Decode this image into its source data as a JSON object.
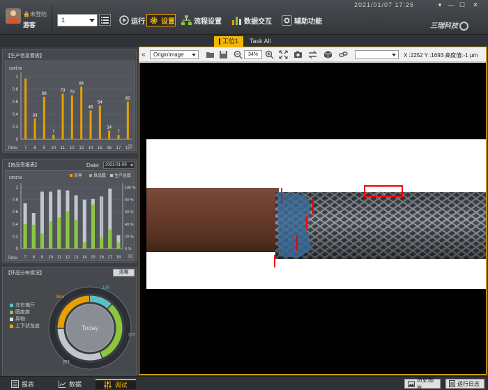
{
  "header": {
    "login_status": "未登陆",
    "user_name": "游客",
    "station_value": "1",
    "nav": {
      "run": "运行",
      "settings": "设置",
      "flow": "流程设置",
      "data": "数据交互",
      "aux": "辅助功能"
    },
    "datetime": "2021/01/07  17:26",
    "brand": "三瑞科技"
  },
  "tabs": [
    "工位1",
    "Task All"
  ],
  "production_panel": {
    "title": "【生产信息看板】",
    "unit": "unit:w",
    "time_label": "Time:",
    "chart_data": {
      "type": "bar",
      "ylabel": "unit:w",
      "ylim": [
        0,
        1
      ],
      "y_ticks": [
        "0",
        "0.2",
        "0.4",
        "0.6",
        "0.8",
        "1"
      ],
      "categories": [
        "7",
        "8",
        "9",
        "10",
        "11",
        "12",
        "13",
        "14",
        "15",
        "16",
        "17",
        "18"
      ],
      "data_labels": [
        "",
        "33",
        "68",
        "7",
        "73",
        "70",
        "84",
        "46",
        "54",
        "14",
        "7",
        "60"
      ],
      "values": [
        0.97,
        0.33,
        0.68,
        0.07,
        0.73,
        0.7,
        0.84,
        0.46,
        0.54,
        0.14,
        0.07,
        0.6
      ]
    }
  },
  "yield_panel": {
    "title": "【良品率报表】",
    "date_label": "Date:",
    "date_value": "2021-01-08",
    "unit": "unit:w",
    "time_label": "Time:",
    "legend": [
      "良率",
      "良品数",
      "生产总数"
    ],
    "chart_data": {
      "type": "bar",
      "ylim": [
        0,
        1
      ],
      "y_ticks": [
        "0",
        "0.2",
        "0.4",
        "0.6",
        "0.8",
        "1"
      ],
      "y2_ticks": [
        "0 %",
        "20 %",
        "40 %",
        "60 %",
        "80 %",
        "100 %"
      ],
      "categories": [
        "7",
        "8",
        "9",
        "10",
        "11",
        "12",
        "13",
        "14",
        "15",
        "16",
        "17",
        "18"
      ],
      "series": [
        {
          "name": "生产总数",
          "values": [
            0.74,
            0.58,
            0.93,
            0.93,
            0.96,
            0.95,
            0.87,
            0.8,
            0.81,
            0.85,
            0.98,
            0.22
          ]
        },
        {
          "name": "良品数",
          "values": [
            0.4,
            0.39,
            0.25,
            0.45,
            0.51,
            0.61,
            0.47,
            0.11,
            0.72,
            0.18,
            0.31,
            0.1
          ]
        },
        {
          "name": "良率",
          "values": [
            0,
            0,
            0,
            0,
            0,
            0,
            0,
            0,
            0,
            0.83,
            0,
            0
          ]
        }
      ],
      "colors": {
        "total": "#c2c6cf",
        "good": "#8cc63f",
        "rate": "#e8a000"
      }
    }
  },
  "defect_panel": {
    "title": "【环品分布情况】",
    "clear_label": "清零",
    "center_label": "Today",
    "legend": [
      {
        "label": "左右偏斤",
        "color": "#5bc0c0"
      },
      {
        "label": "圆度度",
        "color": "#8cc63f"
      },
      {
        "label": "异物",
        "color": "#e0e0e0"
      },
      {
        "label": "上下状览度",
        "color": "#e8a000"
      }
    ],
    "chart_data": {
      "type": "pie",
      "labels": [
        "128",
        "320",
        "263",
        "26%"
      ],
      "values": [
        12,
        32,
        31,
        25
      ],
      "colors": [
        "#5bc0c0",
        "#8cc63f",
        "#c2c6cf",
        "#e8a000"
      ]
    }
  },
  "viewer": {
    "image_type": "OriginImage",
    "zoom": "34%",
    "coord_readout": "X :2252 Y :1693 高度值:-1 µm"
  },
  "bottom": {
    "tabs": [
      "报表",
      "数据",
      "调试"
    ],
    "history_btn": "历史图片",
    "log_btn": "运行日志"
  }
}
